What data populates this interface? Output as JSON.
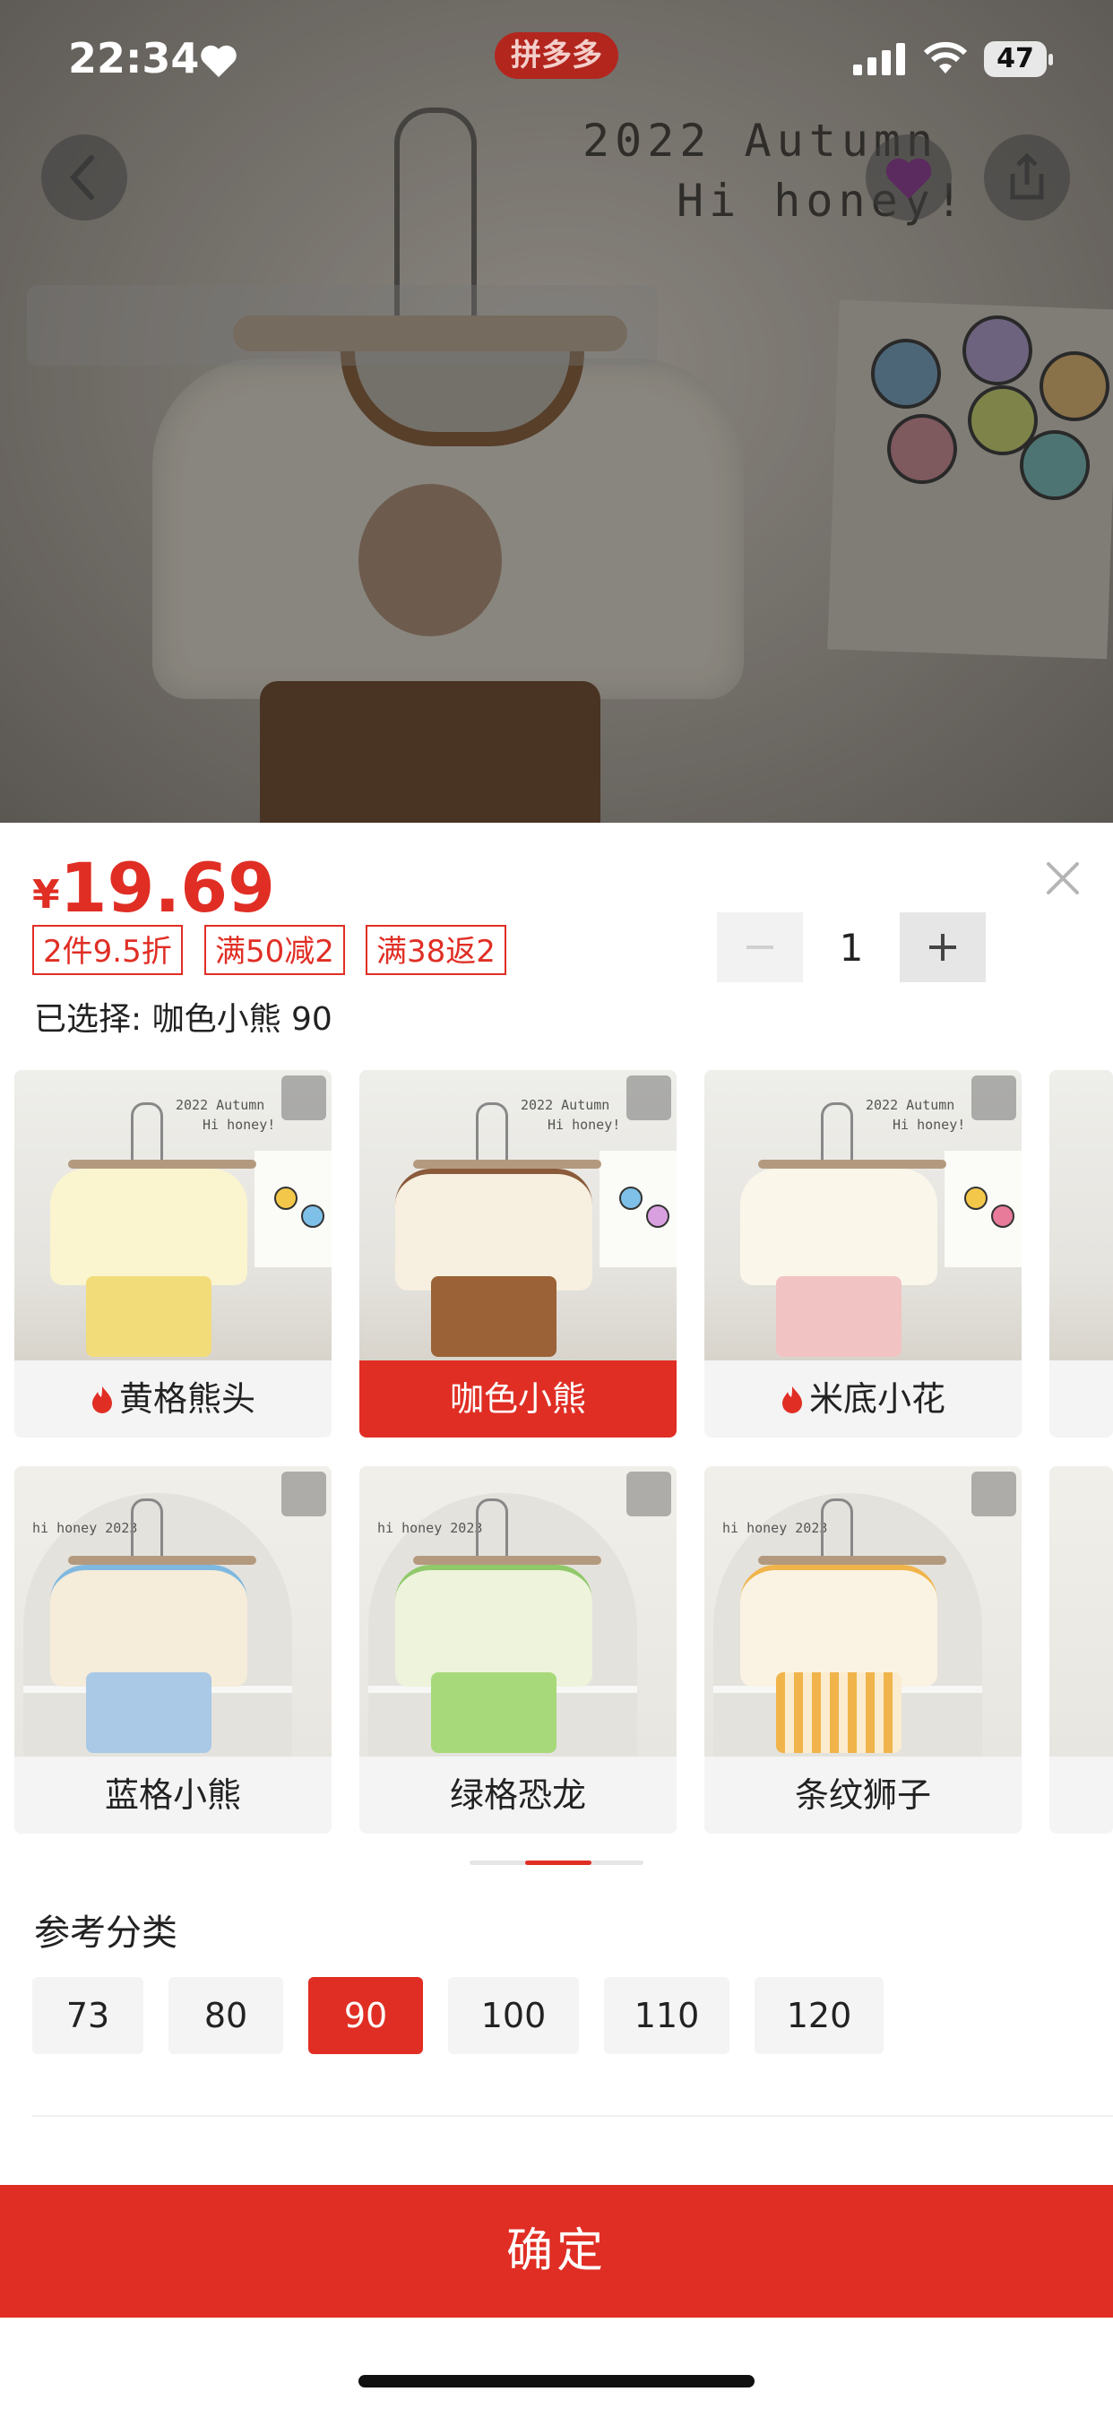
{
  "status_bar": {
    "time": "22:34",
    "app_badge": "拼多多",
    "battery": "47"
  },
  "hero": {
    "text_line1": "2022 Autumn",
    "text_line2": "Hi honey!"
  },
  "sheet": {
    "price_symbol": "¥",
    "price": "19.69",
    "promos": [
      "2件9.5折",
      "满50减2",
      "满38返2"
    ],
    "selected_text": "已选择: 咖色小熊 90",
    "quantity": "1",
    "variants": [
      {
        "label": "黄格熊头",
        "hot": true,
        "selected": false
      },
      {
        "label": "咖色小熊",
        "hot": false,
        "selected": true
      },
      {
        "label": "米底小花",
        "hot": true,
        "selected": false
      },
      {
        "label": "蓝格小熊",
        "hot": false,
        "selected": false
      },
      {
        "label": "绿格恐龙",
        "hot": false,
        "selected": false
      },
      {
        "label": "条纹狮子",
        "hot": false,
        "selected": false
      }
    ],
    "variant_card_text": {
      "line1": "2022 Autumn",
      "line2": "Hi honey!",
      "line3": "hi honey 2023"
    },
    "size_title": "参考分类",
    "sizes": [
      "73",
      "80",
      "90",
      "100",
      "110",
      "120"
    ],
    "selected_size": "90",
    "confirm_label": "确定"
  },
  "colors": {
    "accent": "#e02e24",
    "chip_bg": "#f4f4f4"
  }
}
